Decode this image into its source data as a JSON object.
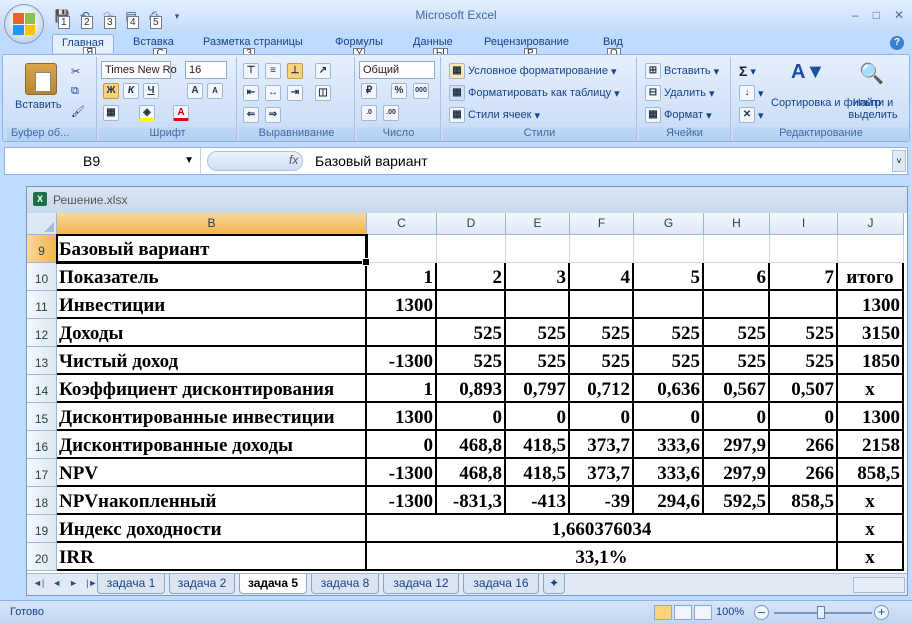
{
  "app": {
    "title": "Microsoft Excel",
    "qat_keys": [
      "1",
      "2",
      "3",
      "4",
      "5"
    ]
  },
  "ribbon_tabs": [
    {
      "label": "Главная",
      "key": "Я"
    },
    {
      "label": "Вставка",
      "key": "С"
    },
    {
      "label": "Разметка страницы",
      "key": "З"
    },
    {
      "label": "Формулы",
      "key": "У"
    },
    {
      "label": "Данные",
      "key": "Ы"
    },
    {
      "label": "Рецензирование",
      "key": "Р"
    },
    {
      "label": "Вид",
      "key": "О"
    }
  ],
  "ribbon": {
    "clipboard": {
      "paste": "Вставить",
      "label": "Буфер об..."
    },
    "font": {
      "name": "Times New Ro",
      "size": "16",
      "bold": "Ж",
      "italic": "К",
      "underline": "Ч",
      "label": "Шрифт"
    },
    "alignment": {
      "label": "Выравнивание"
    },
    "number": {
      "format": "Общий",
      "label": "Число"
    },
    "styles": {
      "conditional": "Условное форматирование",
      "as_table": "Форматировать как таблицу",
      "cell_styles": "Стили ячеек",
      "label": "Стили"
    },
    "cells": {
      "insert": "Вставить",
      "delete": "Удалить",
      "format": "Формат",
      "label": "Ячейки"
    },
    "editing": {
      "sort": "Сортировка и фильтр",
      "find": "Найти и выделить",
      "label": "Редактирование"
    }
  },
  "formula_bar": {
    "name_box": "B9",
    "fx": "fx",
    "content": "Базовый вариант"
  },
  "workbook": {
    "title": "Решение.xlsx"
  },
  "columns": [
    "B",
    "C",
    "D",
    "E",
    "F",
    "G",
    "H",
    "I",
    "J"
  ],
  "rows": [
    {
      "num": "9",
      "cells": [
        "Базовый вариант",
        "",
        "",
        "",
        "",
        "",
        "",
        "",
        ""
      ]
    },
    {
      "num": "10",
      "cells": [
        "Показатель",
        "1",
        "2",
        "3",
        "4",
        "5",
        "6",
        "7",
        "итого"
      ]
    },
    {
      "num": "11",
      "cells": [
        "Инвестиции",
        "1300",
        "",
        "",
        "",
        "",
        "",
        "",
        "1300"
      ]
    },
    {
      "num": "12",
      "cells": [
        "Доходы",
        "",
        "525",
        "525",
        "525",
        "525",
        "525",
        "525",
        "3150"
      ]
    },
    {
      "num": "13",
      "cells": [
        "Чистый доход",
        "-1300",
        "525",
        "525",
        "525",
        "525",
        "525",
        "525",
        "1850"
      ]
    },
    {
      "num": "14",
      "cells": [
        "Коэффициент дисконтирования",
        "1",
        "0,893",
        "0,797",
        "0,712",
        "0,636",
        "0,567",
        "0,507",
        "х"
      ]
    },
    {
      "num": "15",
      "cells": [
        "Дисконтированные инвестиции",
        "1300",
        "0",
        "0",
        "0",
        "0",
        "0",
        "0",
        "1300"
      ]
    },
    {
      "num": "16",
      "cells": [
        "Дисконтированные доходы",
        "0",
        "468,8",
        "418,5",
        "373,7",
        "333,6",
        "297,9",
        "266",
        "2158"
      ]
    },
    {
      "num": "17",
      "cells": [
        "NPV",
        "-1300",
        "468,8",
        "418,5",
        "373,7",
        "333,6",
        "297,9",
        "266",
        "858,5"
      ]
    },
    {
      "num": "18",
      "cells": [
        "NPVнакопленный",
        "-1300",
        "-831,3",
        "-413",
        "-39",
        "294,6",
        "592,5",
        "858,5",
        "х"
      ]
    },
    {
      "num": "19",
      "cells": [
        "Индекс доходности",
        "1,660376034",
        "х"
      ]
    },
    {
      "num": "20",
      "cells": [
        "IRR",
        "33,1%",
        "х"
      ]
    }
  ],
  "sheet_tabs": [
    "задача 1",
    "задача 2",
    "задача 5",
    "задача 8",
    "задача 12",
    "задача 16"
  ],
  "active_sheet": "задача 5",
  "status": {
    "ready": "Готово",
    "zoom": "100%"
  }
}
